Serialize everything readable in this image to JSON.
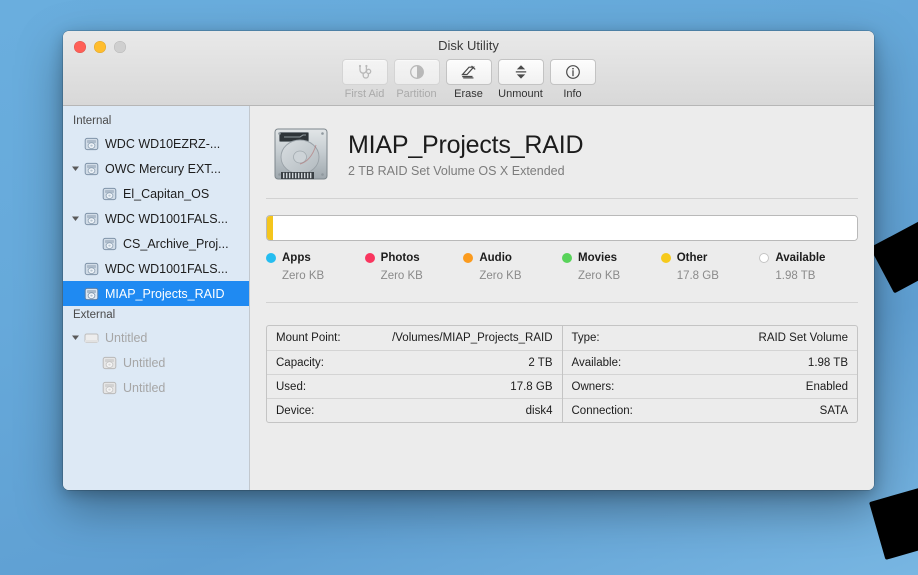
{
  "window": {
    "title": "Disk Utility",
    "traffic_lights": [
      "close",
      "minimize",
      "zoom"
    ]
  },
  "toolbar": {
    "buttons": [
      {
        "label": "First Aid",
        "icon": "stethoscope-icon",
        "enabled": false
      },
      {
        "label": "Partition",
        "icon": "pie-partition-icon",
        "enabled": false
      },
      {
        "label": "Erase",
        "icon": "erase-pencil-icon",
        "enabled": true
      },
      {
        "label": "Unmount",
        "icon": "eject-unmount-icon",
        "enabled": true
      },
      {
        "label": "Info",
        "icon": "info-circle-icon",
        "enabled": true
      }
    ]
  },
  "sidebar": {
    "groups": [
      {
        "title": "Internal",
        "items": [
          {
            "label": "WDC WD10EZRZ-...",
            "indent": 0,
            "triangle": "none",
            "selected": false,
            "dim": false,
            "icon": "disk-icon"
          },
          {
            "label": "OWC Mercury EXT...",
            "indent": 0,
            "triangle": "down",
            "selected": false,
            "dim": false,
            "icon": "disk-icon"
          },
          {
            "label": "El_Capitan_OS",
            "indent": 1,
            "triangle": "none",
            "selected": false,
            "dim": false,
            "icon": "volume-icon"
          },
          {
            "label": "WDC WD1001FALS...",
            "indent": 0,
            "triangle": "down",
            "selected": false,
            "dim": false,
            "icon": "disk-icon"
          },
          {
            "label": "CS_Archive_Proj...",
            "indent": 1,
            "triangle": "none",
            "selected": false,
            "dim": false,
            "icon": "volume-icon"
          },
          {
            "label": "WDC WD1001FALS...",
            "indent": 0,
            "triangle": "none",
            "selected": false,
            "dim": false,
            "icon": "disk-icon"
          },
          {
            "label": "MIAP_Projects_RAID",
            "indent": 0,
            "triangle": "none",
            "selected": true,
            "dim": false,
            "icon": "volume-icon"
          }
        ]
      },
      {
        "title": "External",
        "items": [
          {
            "label": "Untitled",
            "indent": 0,
            "triangle": "down",
            "selected": false,
            "dim": true,
            "icon": "disk-icon"
          },
          {
            "label": "Untitled",
            "indent": 1,
            "triangle": "none",
            "selected": false,
            "dim": true,
            "icon": "volume-icon"
          },
          {
            "label": "Untitled",
            "indent": 1,
            "triangle": "none",
            "selected": false,
            "dim": true,
            "icon": "volume-icon"
          }
        ]
      }
    ]
  },
  "volume": {
    "icon": "hard-drive-icon",
    "name": "MIAP_Projects_RAID",
    "description": "2 TB RAID Set Volume OS X Extended"
  },
  "capacity": {
    "segments": [
      {
        "name": "Other",
        "color": "#f4c51c",
        "percent": 1.0
      },
      {
        "name": "Available",
        "color": "#ffffff",
        "percent": 99.0
      }
    ],
    "legend": [
      {
        "name": "Apps",
        "value": "Zero KB",
        "color": "#25bdf0",
        "hollow": false
      },
      {
        "name": "Photos",
        "value": "Zero KB",
        "color": "#f9365f",
        "hollow": false
      },
      {
        "name": "Audio",
        "value": "Zero KB",
        "color": "#fb9b1e",
        "hollow": false
      },
      {
        "name": "Movies",
        "value": "Zero KB",
        "color": "#58d35a",
        "hollow": false
      },
      {
        "name": "Other",
        "value": "17.8 GB",
        "color": "#f6ca1c",
        "hollow": false
      },
      {
        "name": "Available",
        "value": "1.98 TB",
        "color": "#ffffff",
        "hollow": true
      }
    ]
  },
  "info_table": {
    "left_column": [
      {
        "key": "Mount Point:",
        "value": "/Volumes/MIAP_Projects_RAID"
      },
      {
        "key": "Capacity:",
        "value": "2 TB"
      },
      {
        "key": "Used:",
        "value": "17.8 GB"
      },
      {
        "key": "Device:",
        "value": "disk4"
      }
    ],
    "right_column": [
      {
        "key": "Type:",
        "value": "RAID Set Volume"
      },
      {
        "key": "Available:",
        "value": "1.98 TB"
      },
      {
        "key": "Owners:",
        "value": "Enabled"
      },
      {
        "key": "Connection:",
        "value": "SATA"
      }
    ]
  },
  "colors": {
    "selection_blue": "#1f8af2",
    "sidebar_bg": "#dde9f5",
    "desktop_blue": "#66a9da"
  }
}
